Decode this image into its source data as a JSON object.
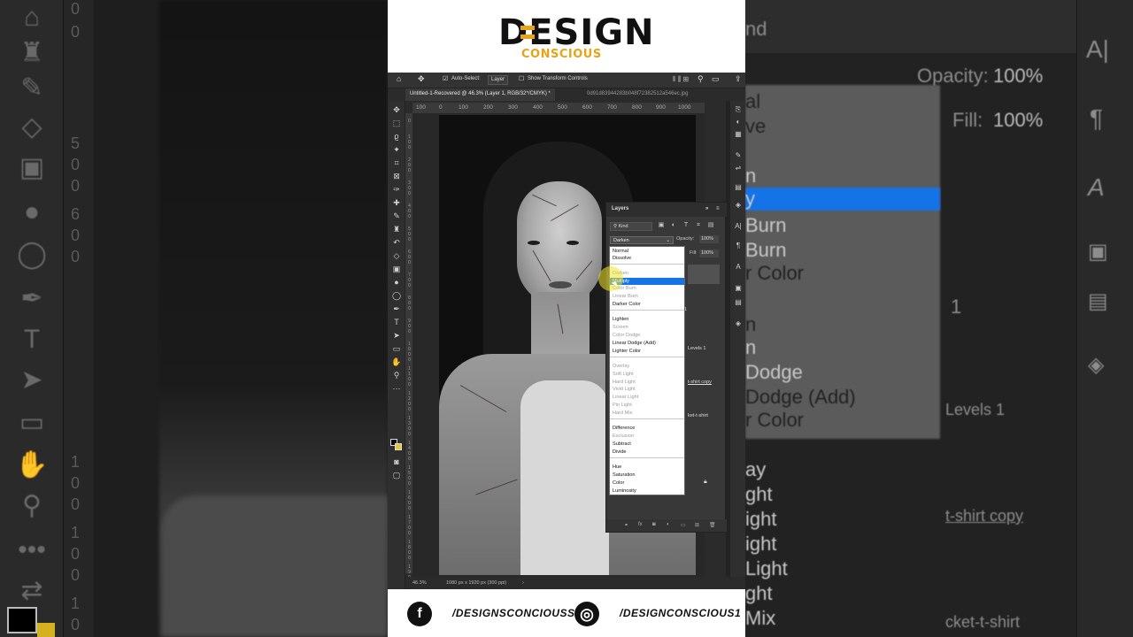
{
  "brand": {
    "name_prefix": "DE",
    "name_rest": "SIGN",
    "tagline": "CONSCIOUS",
    "accent_color": "#e8a317"
  },
  "photoshop": {
    "options_bar": {
      "home_icon": "home-icon",
      "move_icon": "move-icon",
      "auto_select_label": "Auto-Select:",
      "auto_select_value": "Layer",
      "transform_label": "Show Transform Controls"
    },
    "tabs": [
      {
        "label": "Untitled-1-Recovered @ 46.3% (Layer 1, RGB/32*/CMYK) *",
        "active": true
      },
      {
        "label": "0d91d83944283b048f72382512a546ec.jpg",
        "active": false
      }
    ],
    "ruler_ticks": [
      "100",
      "0",
      "100",
      "200",
      "300",
      "400",
      "500",
      "600",
      "700",
      "800",
      "900",
      "1000"
    ],
    "vertical_ruler": [
      "0",
      "1 0 0",
      "2 0 0",
      "3 0 0",
      "4 0 0",
      "5 0 0",
      "6 0 0",
      "7 0 0",
      "8 0 0",
      "9 0 0",
      "1 0 0 0",
      "1 1 0 0",
      "1 2 0 0",
      "1 3 0 0",
      "1 4 0 0",
      "1 5 0 0",
      "1 6 0 0",
      "1 7 0 0",
      "1 8 0 0",
      "1 9 0 0"
    ],
    "status": {
      "zoom": "46.3%",
      "doc_size": "1080 px x 1920 px (300 ppi)"
    },
    "layers_panel": {
      "title": "Layers",
      "kind_filter": "Kind",
      "blend_mode": "Darken",
      "opacity_label": "Opacity:",
      "opacity_value": "100%",
      "fill_label": "Fill:",
      "fill_value": "100%",
      "layer_names": [
        "Levels 1",
        "t-shirt copy",
        "ket-t-shirt"
      ],
      "layer_number": "1"
    },
    "blend_menu": [
      {
        "label": "Normal",
        "dim": false
      },
      {
        "label": "Dissolve",
        "dim": false
      },
      {
        "label": "Darken",
        "dim": true
      },
      {
        "label": "Multiply",
        "dim": false,
        "selected": true
      },
      {
        "label": "Color Burn",
        "dim": true
      },
      {
        "label": "Linear Burn",
        "dim": true
      },
      {
        "label": "Darker Color",
        "dim": false
      },
      {
        "label": "Lighten",
        "dim": false
      },
      {
        "label": "Screen",
        "dim": true
      },
      {
        "label": "Color Dodge",
        "dim": true
      },
      {
        "label": "Linear Dodge (Add)",
        "dim": false
      },
      {
        "label": "Lighter Color",
        "dim": false
      },
      {
        "label": "Overlay",
        "dim": true
      },
      {
        "label": "Soft Light",
        "dim": true
      },
      {
        "label": "Hard Light",
        "dim": true
      },
      {
        "label": "Vivid Light",
        "dim": true
      },
      {
        "label": "Linear Light",
        "dim": true
      },
      {
        "label": "Pin Light",
        "dim": true
      },
      {
        "label": "Hard Mix",
        "dim": true
      },
      {
        "label": "Difference",
        "dim": false
      },
      {
        "label": "Exclusion",
        "dim": true
      },
      {
        "label": "Subtract",
        "dim": false
      },
      {
        "label": "Divide",
        "dim": false
      },
      {
        "label": "Hue",
        "dim": false
      },
      {
        "label": "Saturation",
        "dim": false
      },
      {
        "label": "Color",
        "dim": false
      },
      {
        "label": "Luminosity",
        "dim": false
      }
    ]
  },
  "side_right": {
    "kind": "nd",
    "opacity_label": "Opacity:",
    "opacity_value": "100%",
    "fill_label": "Fill:",
    "fill_value": "100%",
    "frag_1": "al",
    "frag_2": "ve",
    "frag_3": "n",
    "frag_4": "y",
    "frag_5": "Burn",
    "frag_6": "Burn",
    "frag_7": "r Color",
    "frag_8": "n",
    "frag_9": "n",
    "frag_10": "Dodge",
    "frag_11": "Dodge (Add)",
    "frag_12": "r Color",
    "frag_13": "ay",
    "frag_14": "ght",
    "frag_15": "ight",
    "frag_16": "ight",
    "frag_17": "Light",
    "frag_18": "ght",
    "frag_19": "Mix",
    "layer_1": "1",
    "layer_levels": "Levels 1",
    "layer_copy": "t-shirt copy",
    "layer_shirt": "cket-t-shirt"
  },
  "side_left": {
    "ruler_nums": [
      "0",
      "0",
      "5",
      "0",
      "0",
      "6",
      "0",
      "0",
      "1",
      "0",
      "0",
      "1",
      "0",
      "0",
      "1",
      "0"
    ]
  },
  "footer": {
    "facebook_icon": "facebook-icon",
    "facebook_handle": "/DESIGNSCONCIOUSS",
    "instagram_icon": "instagram-icon",
    "instagram_handle": "/DESIGNCONSCIOUS1",
    "fb_glyph": "f",
    "ig_glyph": "◎"
  }
}
